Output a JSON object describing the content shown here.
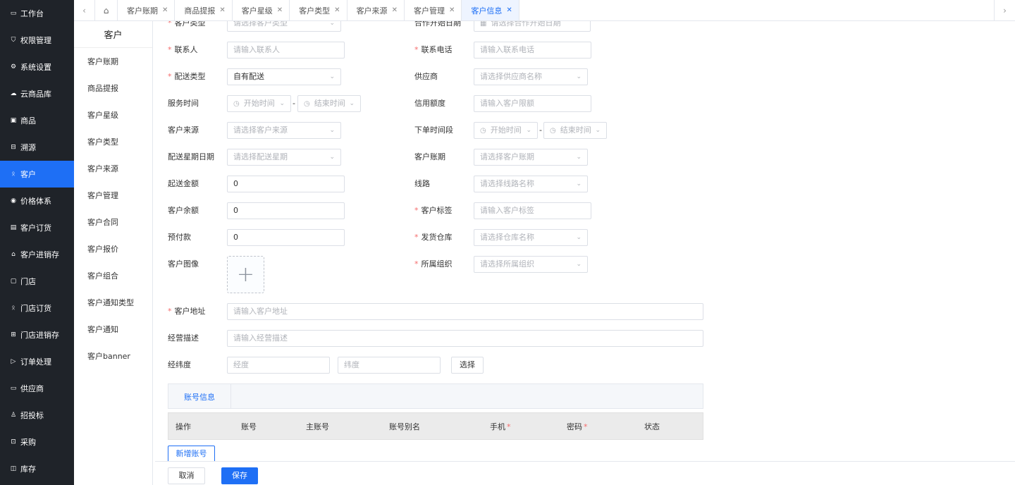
{
  "sidebar": {
    "items": [
      {
        "label": "工作台",
        "icon": "monitor-icon"
      },
      {
        "label": "权限管理",
        "icon": "shield-icon"
      },
      {
        "label": "系统设置",
        "icon": "gear-icon"
      },
      {
        "label": "云商品库",
        "icon": "cloud-icon"
      },
      {
        "label": "商品",
        "icon": "goods-icon"
      },
      {
        "label": "溯源",
        "icon": "trace-icon"
      },
      {
        "label": "客户",
        "icon": "user-icon"
      },
      {
        "label": "价格体系",
        "icon": "price-icon"
      },
      {
        "label": "客户订货",
        "icon": "order-icon"
      },
      {
        "label": "客户进销存",
        "icon": "warehouse-icon"
      },
      {
        "label": "门店",
        "icon": "store-icon"
      },
      {
        "label": "门店订货",
        "icon": "store-order-icon"
      },
      {
        "label": "门店进销存",
        "icon": "store-stock-icon"
      },
      {
        "label": "订单处理",
        "icon": "send-icon"
      },
      {
        "label": "供应商",
        "icon": "supplier-icon"
      },
      {
        "label": "招投标",
        "icon": "bid-icon"
      },
      {
        "label": "采购",
        "icon": "purchase-icon"
      },
      {
        "label": "库存",
        "icon": "inventory-icon"
      }
    ],
    "active_index": 6
  },
  "tabs": {
    "items": [
      "客户账期",
      "商品提报",
      "客户星级",
      "客户类型",
      "客户来源",
      "客户管理",
      "客户信息"
    ],
    "active": "客户信息"
  },
  "submenu": {
    "title": "客户",
    "items": [
      "客户账期",
      "商品提报",
      "客户星级",
      "客户类型",
      "客户来源",
      "客户管理",
      "客户合同",
      "客户报价",
      "客户组合",
      "客户通知类型",
      "客户通知",
      "客户banner"
    ]
  },
  "form": {
    "customer_type": {
      "label": "客户类型",
      "placeholder": "请选择客户类型"
    },
    "coop_start": {
      "label": "合作开始日期",
      "placeholder": "请选择合作开始日期"
    },
    "contact": {
      "label": "联系人",
      "placeholder": "请输入联系人"
    },
    "phone": {
      "label": "联系电话",
      "placeholder": "请输入联系电话"
    },
    "delivery_type": {
      "label": "配送类型",
      "value": "自有配送"
    },
    "supplier": {
      "label": "供应商",
      "placeholder": "请选择供应商名称"
    },
    "service_time": {
      "label": "服务时间",
      "start": "开始时间",
      "end": "结束时间"
    },
    "credit": {
      "label": "信用额度",
      "placeholder": "请输入客户限额"
    },
    "source": {
      "label": "客户来源",
      "placeholder": "请选择客户来源"
    },
    "order_time": {
      "label": "下单时间段",
      "start": "开始时间",
      "end": "结束时间"
    },
    "delivery_week": {
      "label": "配送星期日期",
      "placeholder": "请选择配送星期"
    },
    "account_period": {
      "label": "客户账期",
      "placeholder": "请选择客户账期"
    },
    "min_amount": {
      "label": "起送金额",
      "value": "0"
    },
    "route": {
      "label": "线路",
      "placeholder": "请选择线路名称"
    },
    "balance": {
      "label": "客户余额",
      "value": "0"
    },
    "tag": {
      "label": "客户标签",
      "placeholder": "请输入客户标签"
    },
    "prepay": {
      "label": "预付款",
      "value": "0"
    },
    "warehouse": {
      "label": "发货仓库",
      "placeholder": "请选择仓库名称"
    },
    "image": {
      "label": "客户图像"
    },
    "org": {
      "label": "所属组织",
      "placeholder": "请选择所属组织"
    },
    "address": {
      "label": "客户地址",
      "placeholder": "请输入客户地址"
    },
    "description": {
      "label": "经营描述",
      "placeholder": "请输入经营描述"
    },
    "lnglat": {
      "label": "经纬度",
      "lng_placeholder": "经度",
      "lat_placeholder": "纬度",
      "select_label": "选择"
    }
  },
  "account": {
    "tab_label": "账号信息",
    "columns": [
      "操作",
      "账号",
      "主账号",
      "账号别名",
      "手机",
      "密码",
      "状态"
    ],
    "add_label": "新增账号"
  },
  "footer": {
    "cancel_label": "取消",
    "save_label": "保存"
  },
  "colors": {
    "accent": "#1e6ff5",
    "sidebar_bg": "#1f2329",
    "required": "#f56c6c"
  }
}
